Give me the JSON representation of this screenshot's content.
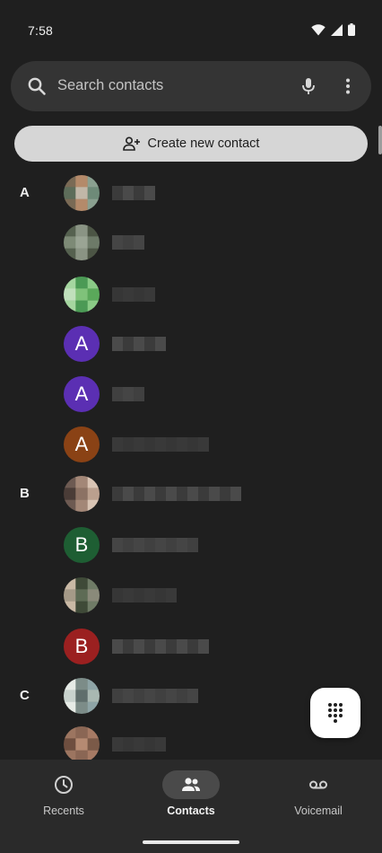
{
  "status_bar": {
    "time": "7:58",
    "icons": [
      "wifi-icon",
      "cellular-signal-icon",
      "battery-icon"
    ]
  },
  "search": {
    "placeholder": "Search contacts",
    "icons": [
      "search-icon",
      "microphone-icon",
      "more-vert-icon"
    ]
  },
  "create_contact": {
    "label": "Create new contact",
    "icon": "person-add-icon"
  },
  "contacts": [
    {
      "section": "A",
      "avatar": {
        "type": "photo",
        "colors": [
          "#7a6a55",
          "#b48a6a",
          "#8aa090",
          "#5d6d5a",
          "#c1b7a8",
          "#6e8a78"
        ]
      },
      "name_redacted": true
    },
    {
      "section": "",
      "avatar": {
        "type": "photo",
        "colors": [
          "#6d7a68",
          "#55614f",
          "#8a9484",
          "#4c5545",
          "#7d8a76",
          "#9aa494"
        ]
      },
      "name_redacted": true
    },
    {
      "section": "",
      "avatar": {
        "type": "photo",
        "colors": [
          "#7fc27a",
          "#5aa85a",
          "#a5d6a0",
          "#4b9a55",
          "#8acb86",
          "#c0e0bc"
        ]
      },
      "name_redacted": true
    },
    {
      "section": "",
      "avatar": {
        "type": "initial",
        "letter": "A",
        "color": "#5b2fb3"
      },
      "name_redacted": true
    },
    {
      "section": "",
      "avatar": {
        "type": "initial",
        "letter": "A",
        "color": "#5b2fb3"
      },
      "name_redacted": true
    },
    {
      "section": "",
      "avatar": {
        "type": "initial",
        "letter": "A",
        "color": "#8a4215"
      },
      "name_redacted": true
    },
    {
      "section": "B",
      "avatar": {
        "type": "photo",
        "colors": [
          "#6d5a52",
          "#a38777",
          "#d9c4b4",
          "#4a3c37",
          "#8c7264",
          "#bba08e"
        ]
      },
      "name_redacted": true
    },
    {
      "section": "",
      "avatar": {
        "type": "initial",
        "letter": "B",
        "color": "#1e5e33"
      },
      "name_redacted": true
    },
    {
      "section": "",
      "avatar": {
        "type": "photo",
        "colors": [
          "#5e6b55",
          "#8a8a7a",
          "#c9b9a5",
          "#3f4a38",
          "#6f7b66",
          "#a59a88"
        ]
      },
      "name_redacted": true
    },
    {
      "section": "",
      "avatar": {
        "type": "initial",
        "letter": "B",
        "color": "#9b2020"
      },
      "name_redacted": true
    },
    {
      "section": "C",
      "avatar": {
        "type": "photo",
        "colors": [
          "#8ea4a6",
          "#c8d2cd",
          "#5f6e6c",
          "#a9b8b2",
          "#e6ebe6",
          "#7c8c88"
        ]
      },
      "name_redacted": true
    },
    {
      "section": "",
      "avatar": {
        "type": "photo",
        "colors": [
          "#8a6654",
          "#a67a64",
          "#6e4e3f",
          "#b58a72",
          "#7b5a48",
          "#9c7560"
        ]
      },
      "name_redacted": true
    }
  ],
  "fab": {
    "icon": "dialpad-icon"
  },
  "bottom_nav": {
    "items": [
      {
        "label": "Recents",
        "icon": "clock-icon",
        "active": false
      },
      {
        "label": "Contacts",
        "icon": "people-icon",
        "active": true
      },
      {
        "label": "Voicemail",
        "icon": "voicemail-icon",
        "active": false
      }
    ]
  },
  "colors": {
    "background": "#1f1f1f",
    "search_bar": "#343434",
    "create_button": "#d6d6d6",
    "bottom_nav": "#2a2a2a",
    "active_pill": "#4a4a4a"
  }
}
